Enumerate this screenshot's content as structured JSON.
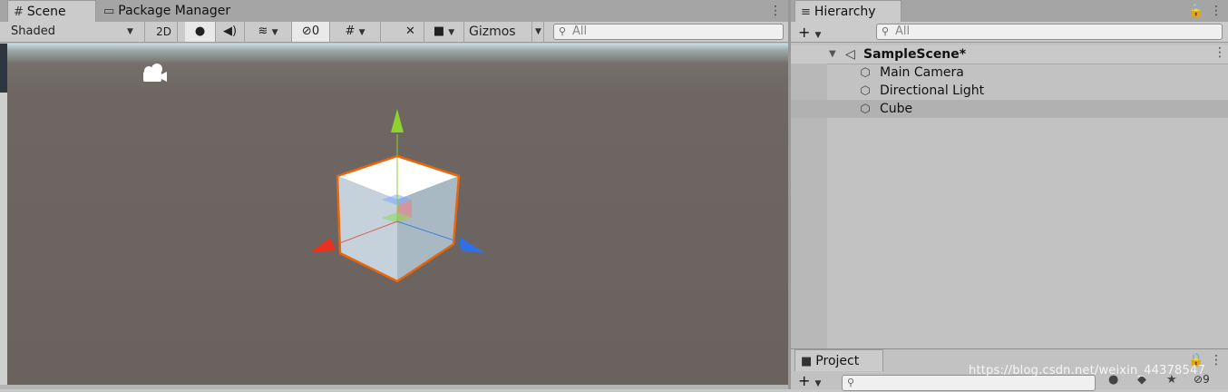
{
  "scene_window": {
    "tabs": [
      {
        "icon": "grid-icon",
        "label": "Scene"
      },
      {
        "icon": "package-icon",
        "label": "Package Manager"
      }
    ],
    "toolbar": {
      "shading_mode": "Shaded",
      "mode_2d": "2D",
      "hidden_count": "0",
      "gizmos_label": "Gizmos",
      "search_placeholder": "All"
    }
  },
  "hierarchy_window": {
    "tab_label": "Hierarchy",
    "search_placeholder": "All",
    "scene_name": "SampleScene*",
    "items": [
      {
        "label": "Main Camera"
      },
      {
        "label": "Directional Light"
      },
      {
        "label": "Cube",
        "selected": true
      }
    ]
  },
  "project_window": {
    "tab_label": "Project",
    "hidden_count": "9"
  },
  "watermark": "https://blog.csdn.net/weixin_44378547",
  "colors": {
    "selection_outline": "#e8660c",
    "gizmo_y": "#8ed22e",
    "gizmo_x": "#e8321e",
    "gizmo_z": "#2f6fe8",
    "viewport_ground": "#6a625e"
  }
}
